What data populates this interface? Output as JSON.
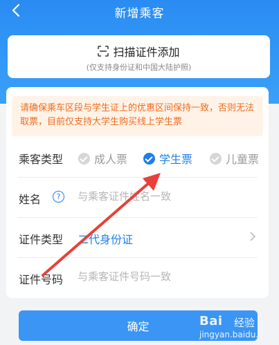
{
  "header": {
    "title": "新增乘客"
  },
  "scan": {
    "label": "扫描证件添加",
    "sub": "(仅支持身份证和中国大陆护照)"
  },
  "notice": {
    "text": "请确保乘车区段与学生证上的优惠区间保持一致，否则无法取票，目前仅支持大学生购买线上学生票"
  },
  "passenger_type": {
    "label": "乘客类型",
    "options": [
      {
        "label": "成人票",
        "selected": false
      },
      {
        "label": "学生票",
        "selected": true
      },
      {
        "label": "儿童票",
        "selected": false
      }
    ]
  },
  "name": {
    "label": "姓名",
    "placeholder": "与乘客证件姓名一致",
    "help_icon": "question-circle-icon"
  },
  "cert_type": {
    "label": "证件类型",
    "value": "二代身份证"
  },
  "cert_no": {
    "label": "证件号码",
    "placeholder": "与乘客证件号码一致"
  },
  "confirm": {
    "label": "确定"
  },
  "watermark": {
    "brand": "Bai",
    "tail": "经验",
    "url": "jingyan.baidu.com"
  },
  "colors": {
    "primary": "#1f7ee9",
    "header": "#2a8cf3",
    "notice_text": "#f06b1e",
    "notice_bg": "#fff3e8",
    "arrow": "#e8403a"
  }
}
